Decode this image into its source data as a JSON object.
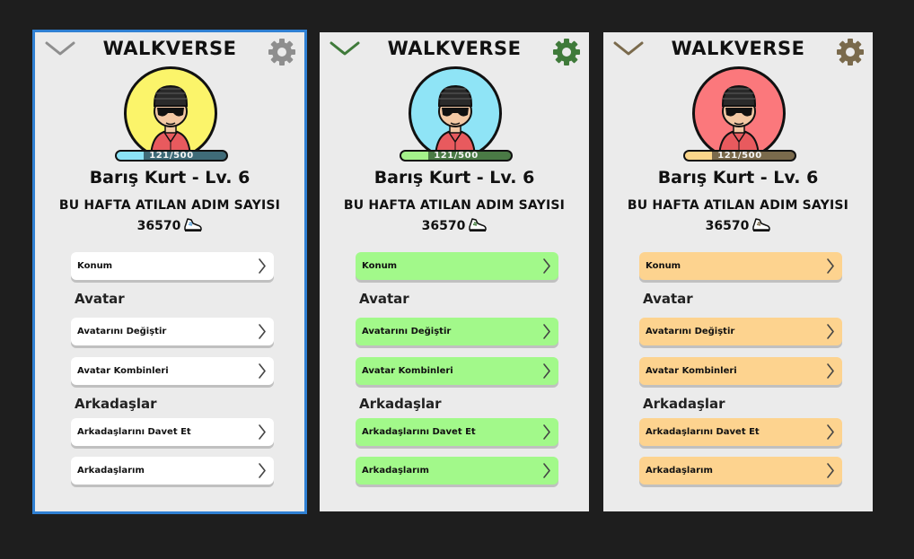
{
  "screens": [
    {
      "variant": "blue",
      "selected": true,
      "app_title": "WALKVERSE",
      "user_name": "Barış Kurt - Lv. 6",
      "xp_text": "121/500",
      "xp_progress": 0.242,
      "steps_heading": "BU HAFTA ATILAN ADIM SAYISI",
      "steps_value": "36570",
      "colors": {
        "avatar_bg": "#fbf46a",
        "bar_bg": "#3f6b78",
        "bar_fill": "#8be3f6",
        "button_bg": "#ffffff",
        "icon": "#8e8e8e"
      },
      "menu": {
        "location": "Konum",
        "avatar_section": "Avatar",
        "change_avatar": "Avatarını Değiştir",
        "avatar_combos": "Avatar Kombinleri",
        "friends_section": "Arkadaşlar",
        "invite_friends": "Arkadaşlarını Davet Et",
        "my_friends": "Arkadaşlarım"
      }
    },
    {
      "variant": "green",
      "selected": false,
      "app_title": "WALKVERSE",
      "user_name": "Barış Kurt - Lv. 6",
      "xp_text": "121/500",
      "xp_progress": 0.242,
      "steps_heading": "BU HAFTA ATILAN ADIM SAYISI",
      "steps_value": "36570",
      "colors": {
        "avatar_bg": "#8fe4f6",
        "bar_bg": "#4a7a45",
        "bar_fill": "#a4f28a",
        "button_bg": "#a2f98a",
        "icon": "#3f7a3a"
      },
      "menu": {
        "location": "Konum",
        "avatar_section": "Avatar",
        "change_avatar": "Avatarını Değiştir",
        "avatar_combos": "Avatar Kombinleri",
        "friends_section": "Arkadaşlar",
        "invite_friends": "Arkadaşlarını Davet Et",
        "my_friends": "Arkadaşlarım"
      }
    },
    {
      "variant": "orange",
      "selected": false,
      "app_title": "WALKVERSE",
      "user_name": "Barış Kurt - Lv. 6",
      "xp_text": "121/500",
      "xp_progress": 0.242,
      "steps_heading": "BU HAFTA ATILAN ADIM SAYISI",
      "steps_value": "36570",
      "colors": {
        "avatar_bg": "#fb787c",
        "bar_bg": "#7a6a4c",
        "bar_fill": "#fbd58a",
        "button_bg": "#fdd38f",
        "icon": "#7a6a4c"
      },
      "menu": {
        "location": "Konum",
        "avatar_section": "Avatar",
        "change_avatar": "Avatarını Değiştir",
        "avatar_combos": "Avatar Kombinleri",
        "friends_section": "Arkadaşlar",
        "invite_friends": "Arkadaşlarını Davet Et",
        "my_friends": "Arkadaşlarım"
      }
    }
  ]
}
